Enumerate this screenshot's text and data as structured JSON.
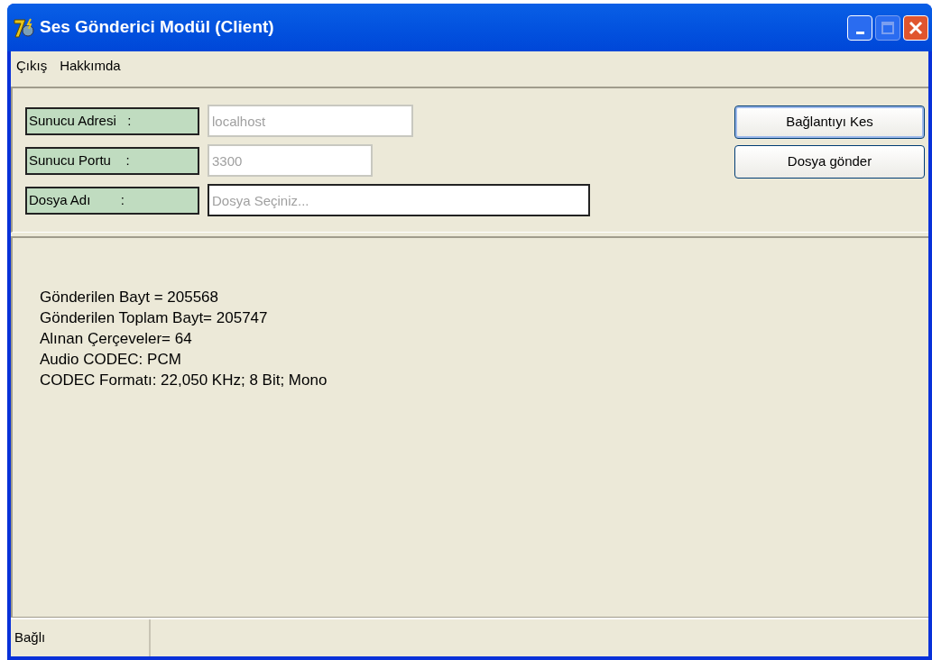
{
  "window": {
    "title": "Ses Gönderici Modül (Client)"
  },
  "menu": [
    "Çıkış",
    "Hakkımda"
  ],
  "fields": [
    {
      "label": "Sunucu Adresi   :",
      "value": "localhost",
      "disabled": true
    },
    {
      "label": "Sunucu Portu    :",
      "value": "3300",
      "disabled": true
    },
    {
      "label": "Dosya Adı        :",
      "placeholder": "Dosya Seçiniz...",
      "disabled": false
    }
  ],
  "buttons": [
    {
      "label": "Bağlantıyı Kes",
      "focused": true
    },
    {
      "label": "Dosya gönder",
      "focused": false
    }
  ],
  "info_lines": [
    "Gönderilen Bayt = 205568",
    "Gönderilen Toplam Bayt= 205747",
    "Alınan Çerçeveler= 64",
    "Audio CODEC: PCM",
    "CODEC Formatı: 22,050 KHz; 8 Bit; Mono"
  ],
  "status_bar": [
    "Bağlı"
  ]
}
